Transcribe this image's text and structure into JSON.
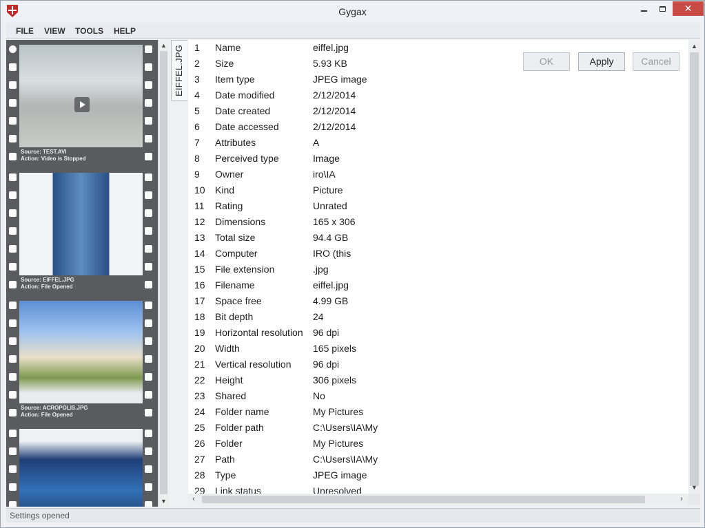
{
  "window": {
    "title": "Gygax",
    "minimize_glyph": "",
    "maximize_glyph": "",
    "close_glyph": "✕"
  },
  "menu": [
    "FILE",
    "VIEW",
    "TOOLS",
    "HELP"
  ],
  "filmstrip": [
    {
      "source": "Source: TEST.AVI",
      "action": "Action: Video is Stopped",
      "image": "video-thumbnail-quarry"
    },
    {
      "source": "Source: EIFFEL.JPG",
      "action": "Action: File Opened",
      "image": "eiffel-tower-photo"
    },
    {
      "source": "Source: ACROPOLIS.JPG",
      "action": "Action: File Opened",
      "image": "acropolis-photo"
    },
    {
      "source": "",
      "action": "",
      "image": "tower-bridge-photo"
    }
  ],
  "tab": {
    "label": "EIFFEL.JPG"
  },
  "buttons": {
    "ok": "OK",
    "apply": "Apply",
    "cancel": "Cancel"
  },
  "properties": [
    {
      "n": "1",
      "name": "Name",
      "value": "eiffel.jpg"
    },
    {
      "n": "2",
      "name": "Size",
      "value": "5.93 KB"
    },
    {
      "n": "3",
      "name": "Item type",
      "value": "JPEG image"
    },
    {
      "n": "4",
      "name": "Date modified",
      "value": "2/12/2014"
    },
    {
      "n": "5",
      "name": "Date created",
      "value": "2/12/2014"
    },
    {
      "n": "6",
      "name": "Date accessed",
      "value": "2/12/2014"
    },
    {
      "n": "7",
      "name": "Attributes",
      "value": "A"
    },
    {
      "n": "8",
      "name": "Perceived type",
      "value": "Image"
    },
    {
      "n": "9",
      "name": "Owner",
      "value": "iro\\IA"
    },
    {
      "n": "10",
      "name": "Kind",
      "value": "Picture"
    },
    {
      "n": "11",
      "name": "Rating",
      "value": "Unrated"
    },
    {
      "n": "12",
      "name": "Dimensions",
      "value": "165 x 306"
    },
    {
      "n": "13",
      "name": "Total size",
      "value": "94.4 GB"
    },
    {
      "n": "14",
      "name": "Computer",
      "value": "IRO (this"
    },
    {
      "n": "15",
      "name": "File extension",
      "value": ".jpg"
    },
    {
      "n": "16",
      "name": "Filename",
      "value": "eiffel.jpg"
    },
    {
      "n": "17",
      "name": "Space free",
      "value": "4.99 GB"
    },
    {
      "n": "18",
      "name": "Bit depth",
      "value": "24"
    },
    {
      "n": "19",
      "name": "Horizontal resolution",
      "value": "96 dpi"
    },
    {
      "n": "20",
      "name": "Width",
      "value": "165 pixels"
    },
    {
      "n": "21",
      "name": "Vertical resolution",
      "value": "96 dpi"
    },
    {
      "n": "22",
      "name": "Height",
      "value": "306 pixels"
    },
    {
      "n": "23",
      "name": "Shared",
      "value": "No"
    },
    {
      "n": "24",
      "name": "Folder name",
      "value": "My Pictures"
    },
    {
      "n": "25",
      "name": "Folder path",
      "value": "C:\\Users\\IA\\My"
    },
    {
      "n": "26",
      "name": "Folder",
      "value": "My Pictures"
    },
    {
      "n": "27",
      "name": "Path",
      "value": "C:\\Users\\IA\\My"
    },
    {
      "n": "28",
      "name": "Type",
      "value": "JPEG image"
    },
    {
      "n": "29",
      "name": "Link status",
      "value": "Unresolved"
    }
  ],
  "status": {
    "text": "Settings opened"
  },
  "scroll_glyphs": {
    "up": "▲",
    "down": "▼",
    "left": "‹",
    "right": "›"
  }
}
